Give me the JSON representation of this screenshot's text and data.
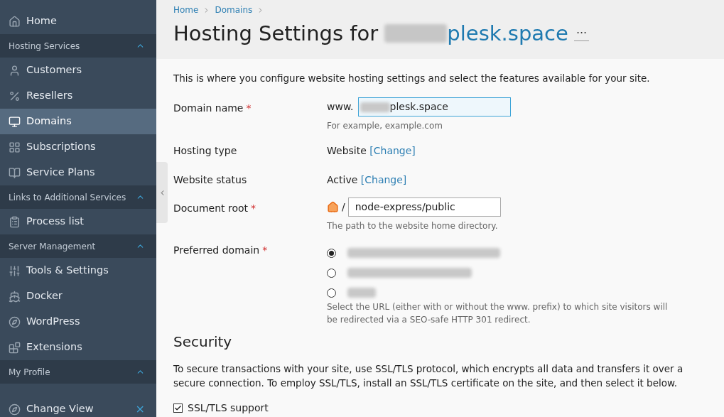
{
  "sidebar": {
    "items": [
      {
        "kind": "item",
        "label": "Home",
        "selected": false
      },
      {
        "kind": "group",
        "label": "Hosting Services",
        "expanded": true
      },
      {
        "kind": "item",
        "label": "Customers",
        "selected": false
      },
      {
        "kind": "item",
        "label": "Resellers",
        "selected": false
      },
      {
        "kind": "item",
        "label": "Domains",
        "selected": true
      },
      {
        "kind": "item",
        "label": "Subscriptions",
        "selected": false
      },
      {
        "kind": "item",
        "label": "Service Plans",
        "selected": false
      },
      {
        "kind": "group",
        "label": "Links to Additional Services",
        "expanded": true
      },
      {
        "kind": "item",
        "label": "Process list",
        "selected": false
      },
      {
        "kind": "group",
        "label": "Server Management",
        "expanded": true
      },
      {
        "kind": "item",
        "label": "Tools & Settings",
        "selected": false
      },
      {
        "kind": "item",
        "label": "Docker",
        "selected": false
      },
      {
        "kind": "item",
        "label": "WordPress",
        "selected": false
      },
      {
        "kind": "item",
        "label": "Extensions",
        "selected": false
      },
      {
        "kind": "group",
        "label": "My Profile",
        "expanded": true
      }
    ],
    "footer": {
      "label": "Change View",
      "close": "×"
    }
  },
  "breadcrumbs": [
    "Home",
    "Domains"
  ],
  "title": {
    "text": "Hosting Settings for ",
    "domain": "plesk.space",
    "more": "···"
  },
  "intro": "This is where you configure website hosting settings and select the features available for your site.",
  "form": {
    "domain_name": {
      "label": "Domain name",
      "required": "*",
      "prefix": "www.",
      "value": "plesk.space",
      "hint": "For example, example.com"
    },
    "hosting_type": {
      "label": "Hosting type",
      "value": "Website",
      "link": "[Change]"
    },
    "website_status": {
      "label": "Website status",
      "value": "Active",
      "link": "[Change]"
    },
    "document_root": {
      "label": "Document root",
      "required": "*",
      "separator": "/",
      "value": "node-express/public",
      "hint": "The path to the website home directory."
    },
    "preferred_domain": {
      "label": "Preferred domain",
      "required": "*",
      "options": [
        {
          "selected": true
        },
        {
          "selected": false
        },
        {
          "selected": false
        }
      ],
      "hint": "Select the URL (either with or without the www. prefix) to which site visitors will be redirected via a SEO-safe HTTP 301 redirect."
    }
  },
  "security": {
    "heading": "Security",
    "text": "To secure transactions with your site, use SSL/TLS protocol, which encrypts all data and transfers it over a secure connection. To employ SSL/TLS, install an SSL/TLS certificate on the site, and then select it below.",
    "ssl": {
      "label": "SSL/TLS support",
      "checked": true
    }
  }
}
